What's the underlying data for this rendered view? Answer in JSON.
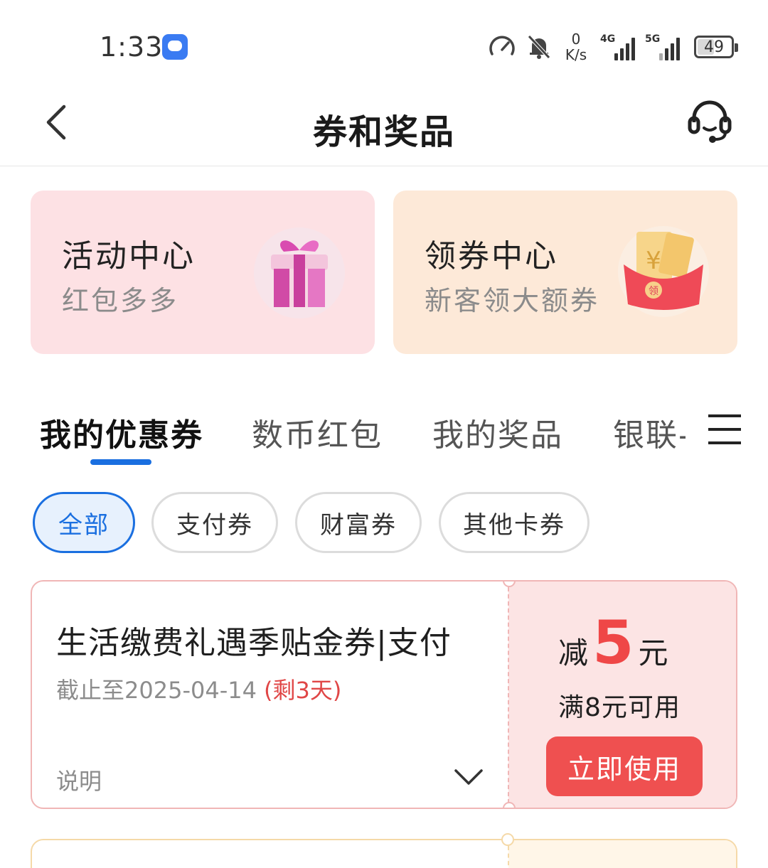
{
  "status_bar": {
    "time": "1:33",
    "net_speed_value": "0",
    "net_speed_unit": "K/s",
    "signal1_label": "4G",
    "signal2_label": "5G",
    "battery": "49"
  },
  "header": {
    "title": "券和奖品"
  },
  "promo_cards": [
    {
      "title": "活动中心",
      "subtitle": "红包多多",
      "icon": "gift-box-icon"
    },
    {
      "title": "领券中心",
      "subtitle": "新客领大额券",
      "icon": "red-envelope-icon"
    }
  ],
  "tabs": [
    {
      "label": "我的优惠券",
      "active": true
    },
    {
      "label": "数币红包",
      "active": false
    },
    {
      "label": "我的奖品",
      "active": false
    },
    {
      "label": "银联-",
      "active": false
    }
  ],
  "filters": [
    {
      "label": "全部",
      "active": true
    },
    {
      "label": "支付券",
      "active": false
    },
    {
      "label": "财富券",
      "active": false
    },
    {
      "label": "其他卡券",
      "active": false
    }
  ],
  "coupon": {
    "title": "生活缴费礼遇季贴金券|支付",
    "expiry": "截止至2025-04-14",
    "remaining": "(剩3天)",
    "explain_label": "说明",
    "amount_prefix": "减",
    "amount": "5",
    "amount_unit": "元",
    "condition": "满8元可用",
    "use_button": "立即使用"
  },
  "colors": {
    "accent_blue": "#1a6fe0",
    "coupon_red": "#ef4747",
    "promo_pink": "#fde1e4",
    "promo_peach": "#fde9d8"
  }
}
